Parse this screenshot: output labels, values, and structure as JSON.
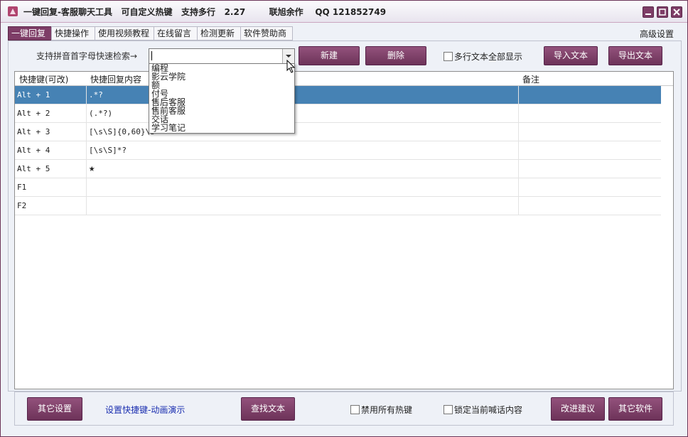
{
  "window": {
    "title": "一键回复-客服聊天工具   可自定义热键   支持多行   2.27        联旭余作    QQ 121852749"
  },
  "tabs": [
    "一键回复",
    "快捷操作",
    "使用视频教程",
    "在线留言",
    "检测更新",
    "软件赞助商"
  ],
  "advanced_settings": "高级设置",
  "search": {
    "label": "支持拼音首字母快速检索→",
    "value": "",
    "options": [
      "编程",
      "影云学院",
      "额",
      "付号",
      "售后客服",
      "售前客服",
      "交话",
      "学习笔记"
    ]
  },
  "toolbar": {
    "new": "新建",
    "delete": "删除",
    "multiline_label": "多行文本全部显示",
    "import": "导入文本",
    "export": "导出文本"
  },
  "table": {
    "headers": [
      "快捷键(可改)",
      "快捷回复内容",
      "备注"
    ],
    "rows": [
      {
        "key": "Alt + 1",
        "content": ".*?",
        "note": ""
      },
      {
        "key": "Alt + 2",
        "content": "(.*?)",
        "note": ""
      },
      {
        "key": "Alt + 3",
        "content": "[\\s\\S]{0,60}\\s",
        "note": ""
      },
      {
        "key": "Alt + 4",
        "content": "[\\s\\S]*?",
        "note": ""
      },
      {
        "key": "Alt + 5",
        "content": "★",
        "note": ""
      },
      {
        "key": "F1",
        "content": "",
        "note": ""
      },
      {
        "key": "F2",
        "content": "",
        "note": ""
      }
    ],
    "selected_index": 0
  },
  "bottom": {
    "other_settings": "其它设置",
    "hotkey_link": "设置快捷键-动画演示",
    "find_text": "查找文本",
    "disable_hotkeys": "禁用所有热键",
    "lock_content": "锁定当前喊话内容",
    "suggest": "改进建议",
    "other_software": "其它软件"
  },
  "colors": {
    "accent": "#7e3d67",
    "selection": "#4682b4",
    "link": "#1b2fb0"
  }
}
